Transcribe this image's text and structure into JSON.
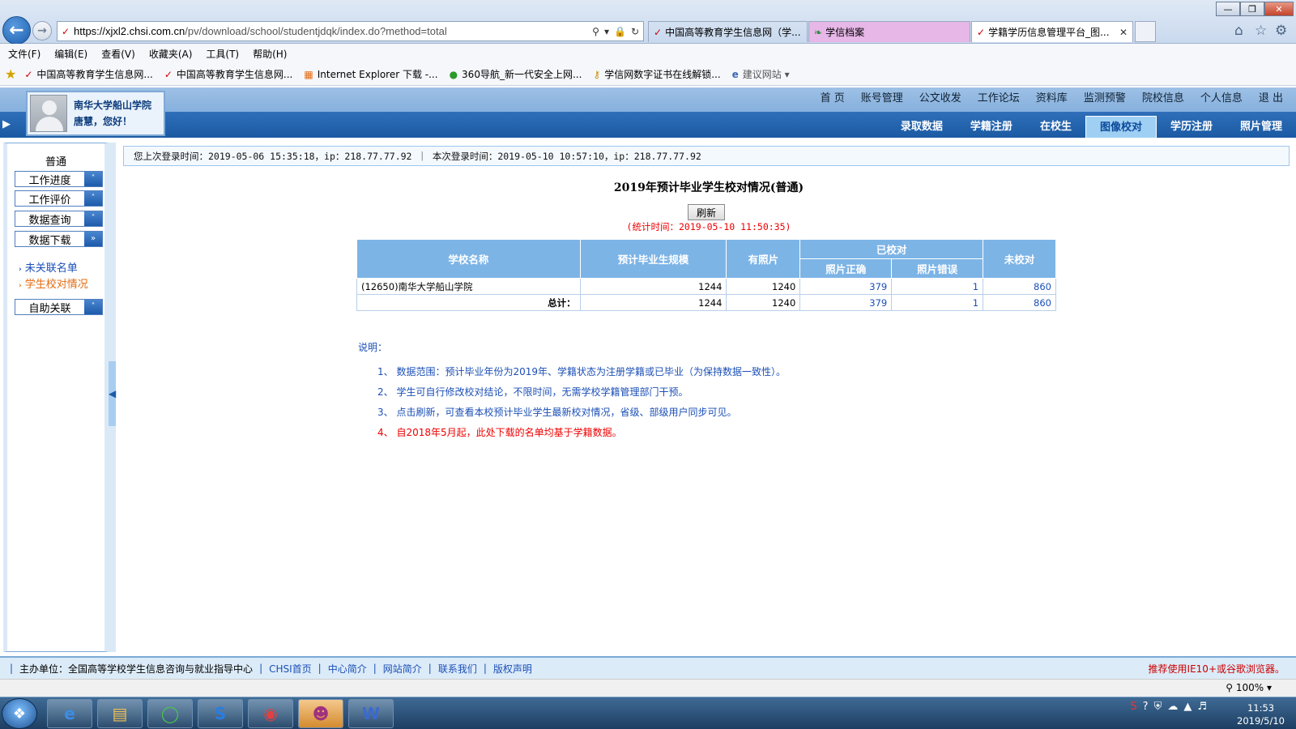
{
  "browser": {
    "url_domain": "https://xjxl2.chsi.com.cn",
    "url_path": "/pv/download/school/studentjdqk/index.do?method=total",
    "tabs": [
      {
        "label": "中国高等教育学生信息网（学...",
        "icon": "chsi-icon"
      },
      {
        "label": "学信档案",
        "icon": "leaf-icon"
      },
      {
        "label": "学籍学历信息管理平台_图...",
        "icon": "chsi-icon"
      }
    ],
    "menu": [
      "文件(F)",
      "编辑(E)",
      "查看(V)",
      "收藏夹(A)",
      "工具(T)",
      "帮助(H)"
    ],
    "favorites": [
      "中国高等教育学生信息网...",
      "中国高等教育学生信息网...",
      "Internet Explorer 下载 -...",
      "360导航_新一代安全上网...",
      "学信网数字证书在线解锁...",
      "建议网站"
    ],
    "zoom": "100%"
  },
  "site": {
    "school": "南华大学船山学院",
    "greeting": "唐慧，您好！",
    "topnav": [
      "首 页",
      "账号管理",
      "公文收发",
      "工作论坛",
      "资料库",
      "监测预警",
      "院校信息",
      "个人信息",
      "退 出"
    ],
    "subnav": [
      "录取数据",
      "学籍注册",
      "在校生",
      "图像校对",
      "学历注册",
      "照片管理"
    ],
    "subnav_active": "图像校对"
  },
  "sidebar": {
    "title": "普通",
    "buttons": [
      "工作进度",
      "工作评价",
      "数据查询",
      "数据下载"
    ],
    "links": [
      "未关联名单",
      "学生校对情况"
    ],
    "button_last": "自助关联"
  },
  "main": {
    "login_info": "您上次登录时间：2019-05-06 15:35:18，ip：218.77.77.92 ｜ 本次登录时间：2019-05-10 10:57:10，ip：218.77.77.92",
    "title": "2019年预计毕业学生校对情况(普通)",
    "refresh_label": "刷新",
    "stat_time": "(统计时间：2019-05-10 11:50:35)",
    "table": {
      "headers": {
        "school": "学校名称",
        "scale": "预计毕业生规模",
        "photo": "有照片",
        "checked": "已校对",
        "correct": "照片正确",
        "wrong": "照片错误",
        "unchecked": "未校对"
      },
      "rows": [
        {
          "school": "(12650)南华大学船山学院",
          "scale": "1244",
          "photo": "1240",
          "correct": "379",
          "wrong": "1",
          "unchecked": "860"
        }
      ],
      "total": {
        "label": "总计：",
        "scale": "1244",
        "photo": "1240",
        "correct": "379",
        "wrong": "1",
        "unchecked": "860"
      }
    },
    "notes_heading": "说明：",
    "notes": [
      "1、  数据范围：预计毕业年份为2019年、学籍状态为注册学籍或已毕业（为保持数据一致性）。",
      "2、  学生可自行修改校对结论，不限时间，无需学校学籍管理部门干预。",
      "3、  点击刷新，可查看本校预计毕业学生最新校对情况，省级、部级用户同步可见。",
      "4、  自2018年5月起，此处下载的名单均基于学籍数据。"
    ]
  },
  "footer": {
    "host": "主办单位：全国高等学校学生信息咨询与就业指导中心",
    "links": [
      "CHSI首页",
      "中心简介",
      "网站简介",
      "联系我们",
      "版权声明"
    ],
    "recommend": "推荐使用IE10+或谷歌浏览器。"
  },
  "taskbar": {
    "time": "11:53",
    "date": "2019/5/10"
  },
  "colors": {
    "accent": "#1d5aab",
    "table_header": "#7db4e6",
    "link_blue": "#1b4fb6",
    "alert_red": "#e00000"
  }
}
